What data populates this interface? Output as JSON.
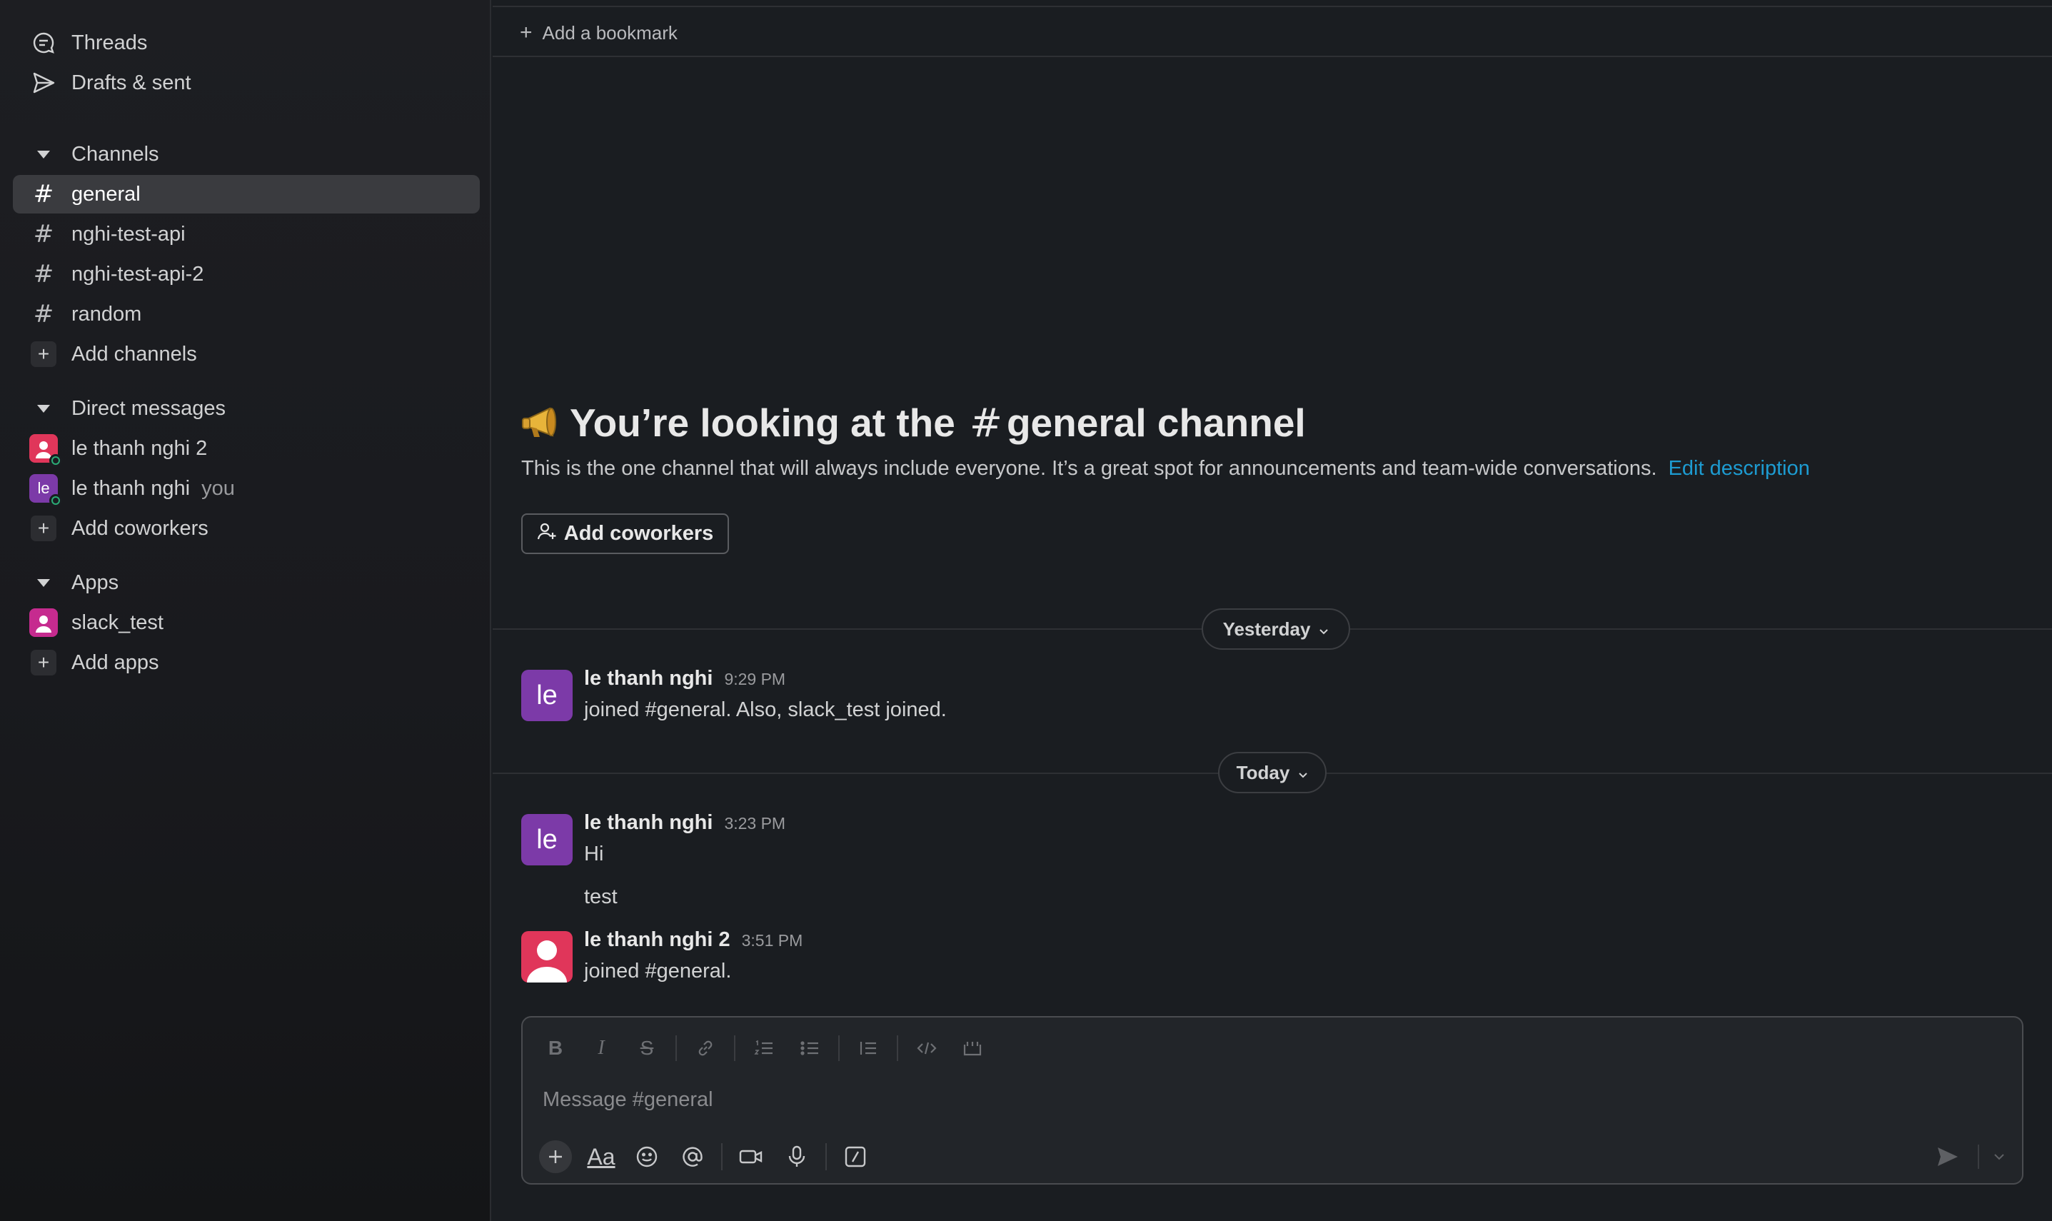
{
  "sidebar": {
    "threads_label": "Threads",
    "drafts_label": "Drafts & sent",
    "channels_header": "Channels",
    "channels": [
      {
        "name": "general",
        "active": true
      },
      {
        "name": "nghi-test-api",
        "active": false
      },
      {
        "name": "nghi-test-api-2",
        "active": false
      },
      {
        "name": "random",
        "active": false
      }
    ],
    "add_channels_label": "Add channels",
    "dm_header": "Direct messages",
    "dms": [
      {
        "name": "le thanh nghi 2",
        "suffix": ""
      },
      {
        "name": "le thanh nghi",
        "suffix": "you",
        "avatar_text": "le"
      }
    ],
    "add_coworkers_label": "Add coworkers",
    "apps_header": "Apps",
    "apps": [
      {
        "name": "slack_test"
      }
    ],
    "add_apps_label": "Add apps"
  },
  "bookmark_bar": {
    "add_bookmark_label": "Add a bookmark"
  },
  "intro": {
    "title_prefix": "You’re looking at the",
    "hash": "#",
    "title_channel": "general channel",
    "description": "This is the one channel that will always include everyone. It’s a great spot for announcements and team-wide conversations.",
    "edit_link": "Edit description",
    "add_coworkers_button": "Add coworkers"
  },
  "dividers": {
    "yesterday": "Yesterday",
    "today": "Today"
  },
  "messages": [
    {
      "author": "le thanh nghi",
      "avatar_text": "le",
      "time": "9:29 PM",
      "lines": [
        "joined #general. Also, slack_test joined."
      ]
    },
    {
      "author": "le thanh nghi",
      "avatar_text": "le",
      "time": "3:23 PM",
      "lines": [
        "Hi",
        "test"
      ]
    },
    {
      "author": "le thanh nghi 2",
      "avatar_text": "",
      "time": "3:51 PM",
      "lines": [
        "joined #general."
      ]
    }
  ],
  "composer": {
    "placeholder": "Message #general",
    "format_tools": [
      "bold-icon",
      "italic-icon",
      "strikethrough-icon",
      "link-icon",
      "ordered-list-icon",
      "bulleted-list-icon",
      "blockquote-icon",
      "code-icon",
      "code-block-icon"
    ],
    "action_tools": [
      "plus-icon",
      "formatting-icon",
      "emoji-icon",
      "mention-icon",
      "video-icon",
      "microphone-icon",
      "shortcuts-icon"
    ],
    "formatting_glyph": "Aa"
  },
  "colors": {
    "background": "#1a1d21",
    "sidebar_active": "#3a3b3f",
    "link": "#1d9bd1",
    "avatar_purple": "#7c3aa8",
    "avatar_red": "#e0365a",
    "presence_green": "#2bac76"
  }
}
